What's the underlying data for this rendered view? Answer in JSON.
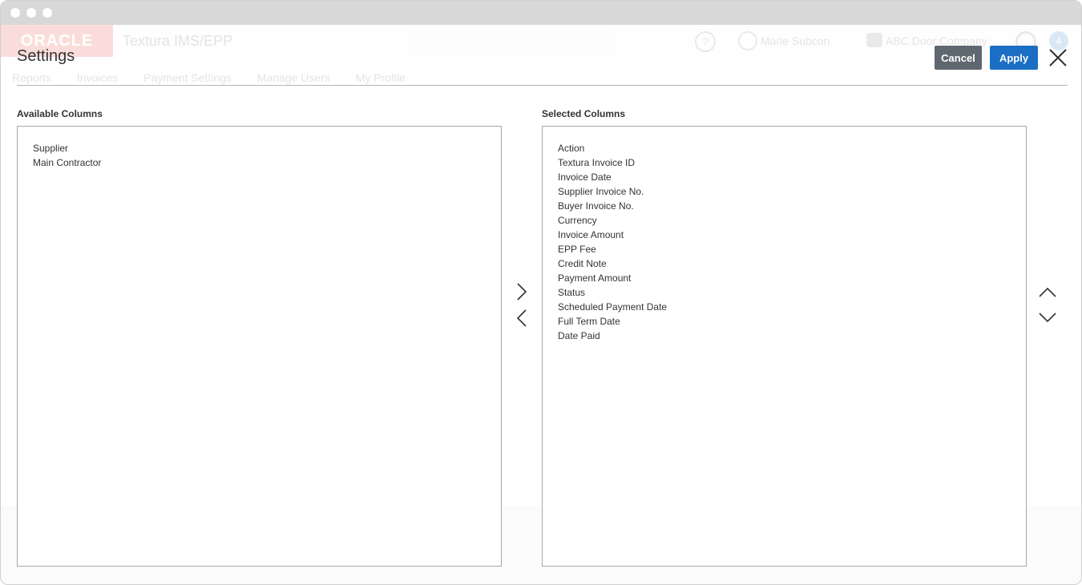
{
  "background_app": {
    "logo": "ORACLE",
    "app_title": "Textura IMS/EPP",
    "help": "?",
    "user_name": "Marie Subcon",
    "company": "ABC Door Company",
    "badge": "4",
    "nav": [
      "Reports",
      "Invoices",
      "Payment Settings",
      "Manage Users",
      "My Profile"
    ]
  },
  "dialog": {
    "title": "Settings",
    "cancel_label": "Cancel",
    "apply_label": "Apply"
  },
  "available": {
    "label": "Available Columns",
    "items": [
      "Supplier",
      "Main Contractor"
    ]
  },
  "selected": {
    "label": "Selected Columns",
    "items": [
      "Action",
      "Textura Invoice ID",
      "Invoice Date",
      "Supplier Invoice No.",
      "Buyer Invoice No.",
      "Currency",
      "Invoice Amount",
      "EPP Fee",
      "Credit Note",
      "Payment Amount",
      "Status",
      "Scheduled Payment Date",
      "Full Term Date",
      "Date Paid"
    ]
  },
  "icons": {
    "close": "close-icon",
    "move_right": "chevron-right-icon",
    "move_left": "chevron-left-icon",
    "move_up": "chevron-up-icon",
    "move_down": "chevron-down-icon"
  },
  "colors": {
    "apply": "#1a6fc4",
    "cancel": "#5f6770",
    "oracle_red": "#e0301e"
  }
}
